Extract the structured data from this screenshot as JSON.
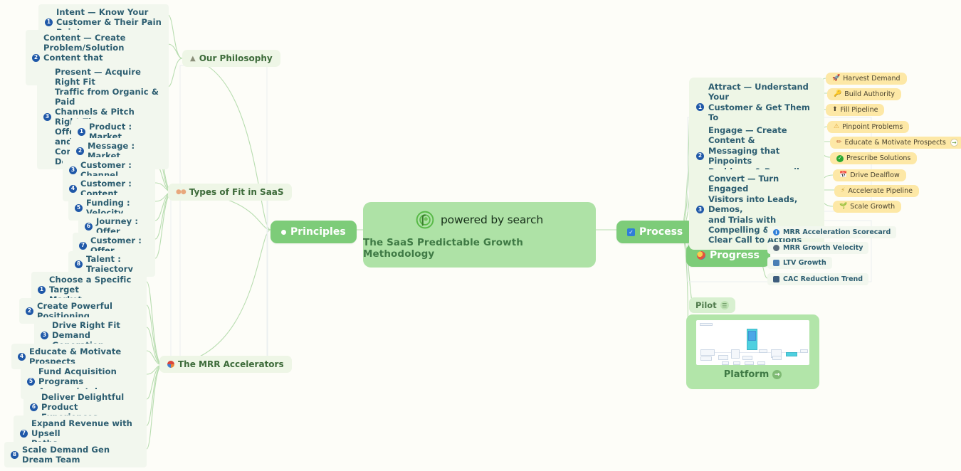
{
  "center": {
    "logo_text": "powered by search",
    "logo_icon": "powered-by-search-logo",
    "tagline": "The SaaS Predictable Growth Methodology"
  },
  "hubs": {
    "principles": {
      "label": "Principles",
      "icon": "white-dot-icon"
    },
    "process": {
      "label": "Process",
      "icon": "blue-checkbox-icon"
    },
    "progress": {
      "label": "Progress",
      "icon": "target-icon"
    }
  },
  "branches": {
    "philosophy": {
      "label": "Our Philosophy",
      "icon": "mountain-icon"
    },
    "types_of_fit": {
      "label": "Types of Fit in SaaS",
      "icon": "footprints-icon"
    },
    "mrr_accelerators": {
      "label": "The MRR Accelerators",
      "icon": "beachball-icon"
    }
  },
  "philosophy_items": [
    {
      "num": "1",
      "text": "Intent — Know Your\nCustomer & Their Pain Points"
    },
    {
      "num": "2",
      "text": "Content — Create\nProblem/Solution Content that\nEducates and Motivates Them"
    },
    {
      "num": "3",
      "text": "Present — Acquire Right Fit\nTraffic from Organic &  Paid\nChannels & Pitch Right Time\nOffers that are Clear and\nCompelling to Drive Dealflow"
    }
  ],
  "fit_items": [
    {
      "num": "1",
      "text": "Product : Market"
    },
    {
      "num": "2",
      "text": "Message : Market"
    },
    {
      "num": "3",
      "text": "Customer : Channel"
    },
    {
      "num": "4",
      "text": "Customer : Content"
    },
    {
      "num": "5",
      "text": "Funding : Velocity"
    },
    {
      "num": "6",
      "text": "Journey : Offer"
    },
    {
      "num": "7",
      "text": "Customer : Offer"
    },
    {
      "num": "8",
      "text": "Talent : Trajectory"
    }
  ],
  "mrr_items": [
    {
      "num": "1",
      "text": "Choose a Specific Target\nMarket"
    },
    {
      "num": "2",
      "text": "Create Powerful Positioning"
    },
    {
      "num": "3",
      "text": "Drive Right Fit Demand\nGeneration"
    },
    {
      "num": "4",
      "text": "Educate & Motivate Prospects"
    },
    {
      "num": "5",
      "text": "Fund Acquisition Programs\nAppropriately"
    },
    {
      "num": "6",
      "text": "Deliver Delightful Product\nExperiences"
    },
    {
      "num": "7",
      "text": "Expand Revenue with Upsell\nPaths"
    },
    {
      "num": "8",
      "text": "Scale Demand Gen Dream Team"
    }
  ],
  "stages": [
    {
      "num": "1",
      "text": "Attract — Understand Your\nCustomer & Get Them To\nDiscover Your SaaS"
    },
    {
      "num": "2",
      "text": "Engage — Create Content &\nMessaging that Pinpoints\nProblems & Prescribes\nSolutions"
    },
    {
      "num": "3",
      "text": "Convert — Turn Engaged\nVisitors into Leads, Demos,\nand Trials with Compelling &\nClear Call to Actions"
    }
  ],
  "attract_tags": [
    {
      "icon": "rocket-icon",
      "glyph": "🚀",
      "label": "Harvest Demand",
      "link": false
    },
    {
      "icon": "key-icon",
      "glyph": "🔑",
      "label": "Build Authority",
      "link": false
    },
    {
      "icon": "up-arrow-icon",
      "glyph": "⬆",
      "label": "Fill Pipeline",
      "link": false
    }
  ],
  "engage_tags": [
    {
      "icon": "warning-icon",
      "glyph": "⚠",
      "label": "Pinpoint Problems",
      "link": false
    },
    {
      "icon": "pencil-icon",
      "glyph": "✏",
      "label": "Educate & Motivate Prospects",
      "link": true
    },
    {
      "icon": "check-circle-icon",
      "glyph": "✔",
      "label": "Prescribe Solutions",
      "link": false
    }
  ],
  "convert_tags": [
    {
      "icon": "calendar-icon",
      "glyph": "📅",
      "label": "Drive Dealflow",
      "link": false
    },
    {
      "icon": "bolt-icon",
      "glyph": "⚡",
      "label": "Accelerate Pipeline",
      "link": false
    },
    {
      "icon": "sprout-icon",
      "glyph": "🌱",
      "label": "Scale Growth",
      "link": false
    }
  ],
  "progress_metrics": [
    {
      "icon": "info-icon",
      "label": "MRR Acceleration Scorecard"
    },
    {
      "icon": "gear-icon",
      "label": "MRR Growth Velocity"
    },
    {
      "icon": "chart-icon",
      "label": "LTV Growth"
    },
    {
      "icon": "down-trend-icon",
      "label": "CAC Reduction Trend"
    }
  ],
  "pilot": {
    "label": "Pilot",
    "icon": "note-icon"
  },
  "platform": {
    "label": "Platform",
    "icon": "arrow-right-circle-icon",
    "thumbnail": "platform-flowchart-screenshot"
  },
  "colors": {
    "page_background": "#fdfdf8",
    "pill_green": "#7dcc79",
    "center_green": "#aee2a6",
    "leaf_pale": "#f2f7ee",
    "branch_pale": "#eef6e6",
    "tag_yellow": "#fde8a6",
    "text_teal": "#2c5d70",
    "text_green": "#3d6b3a",
    "badge_blue": "#1f58a8",
    "connector": "#b8ddb0"
  }
}
